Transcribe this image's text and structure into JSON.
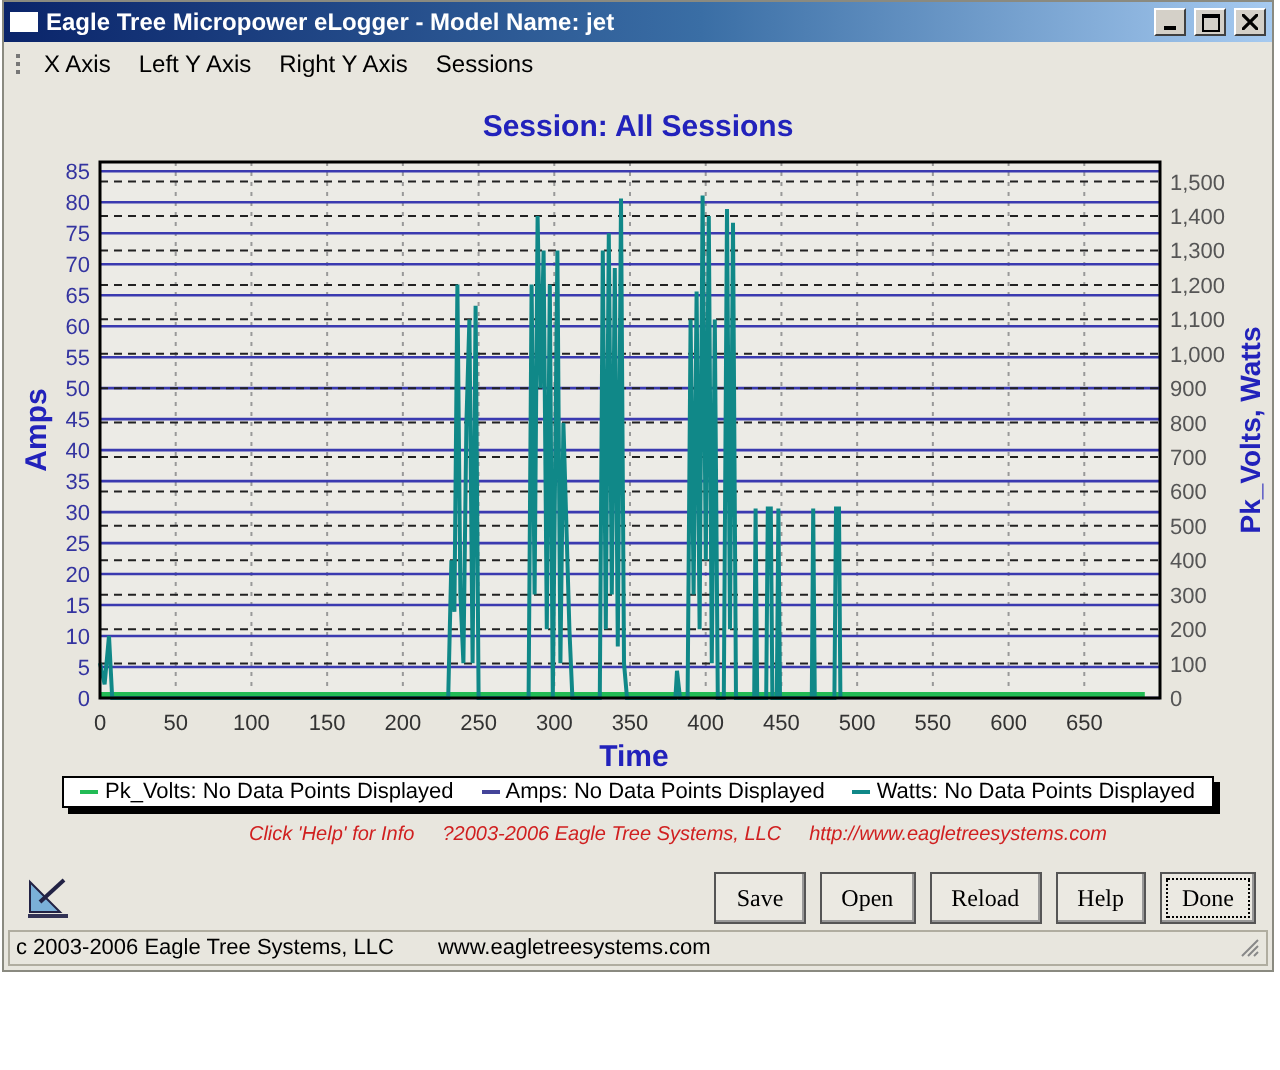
{
  "window": {
    "title": "Eagle Tree Micropower eLogger - Model Name: jet"
  },
  "menu": [
    {
      "label": "X Axis"
    },
    {
      "label": "Left Y Axis"
    },
    {
      "label": "Right Y Axis"
    },
    {
      "label": "Sessions"
    }
  ],
  "graph": {
    "title": "Session: All Sessions",
    "right_axis": {
      "title": "Pk_Volts, Watts",
      "ticks": [
        "1,500",
        "1,400",
        "1,300",
        "1,200",
        "1,100",
        "1,000",
        "900",
        "800",
        "700",
        "600",
        "500",
        "400",
        "300",
        "200",
        "100",
        "0"
      ]
    },
    "chart_data": {
      "type": "line",
      "grid": true,
      "xlabel": "Time",
      "ylabel": "Amps",
      "xlim": [
        0,
        700
      ],
      "ylim": [
        0,
        86.5
      ],
      "xticks": [
        0,
        50,
        100,
        150,
        200,
        250,
        300,
        350,
        400,
        450,
        500,
        550,
        600,
        650
      ],
      "yticks": [
        0,
        5,
        10,
        15,
        20,
        25,
        30,
        35,
        40,
        45,
        50,
        55,
        60,
        65,
        70,
        75,
        80,
        85
      ],
      "x": [
        0,
        3,
        6,
        8,
        230,
        232,
        234,
        236,
        238,
        240,
        242,
        244,
        246,
        248,
        250,
        283,
        285,
        287,
        289,
        291,
        293,
        295,
        297,
        299,
        302,
        304,
        306,
        308,
        310,
        312,
        330,
        332,
        334,
        336,
        338,
        340,
        342,
        344,
        346,
        348,
        380,
        381,
        383,
        388,
        390,
        392,
        394,
        396,
        398,
        400,
        402,
        404,
        406,
        408,
        412,
        414,
        416,
        418,
        420,
        432,
        433,
        434,
        440,
        441,
        443,
        444,
        447,
        448,
        449,
        470,
        471,
        472,
        485,
        486,
        488,
        489,
        690
      ],
      "series": [
        {
          "name": "Pk_Volts",
          "color": "#22bb55",
          "values": [
            0.55,
            0.55,
            0.55,
            0.55,
            0.55,
            0.55,
            0.55,
            0.55,
            0.55,
            0.55,
            0.55,
            0.55,
            0.55,
            0.55,
            0.55,
            0.55,
            0.55,
            0.55,
            0.55,
            0.55,
            0.55,
            0.55,
            0.55,
            0.55,
            0.55,
            0.55,
            0.55,
            0.55,
            0.55,
            0.55,
            0.55,
            0.55,
            0.55,
            0.55,
            0.55,
            0.55,
            0.55,
            0.55,
            0.55,
            0.55,
            0.55,
            0.55,
            0.55,
            0.55,
            0.55,
            0.55,
            0.55,
            0.55,
            0.55,
            0.55,
            0.55,
            0.55,
            0.55,
            0.55,
            0.55,
            0.55,
            0.55,
            0.55,
            0.55,
            0.55,
            0.55,
            0.55,
            0.55,
            0.55,
            0.55,
            0.55,
            0.55,
            0.55,
            0.55,
            0.55,
            0.55,
            0.55,
            0.55,
            0.55,
            0.55,
            0.55,
            0.55
          ]
        },
        {
          "name": "Watts",
          "color": "#108888",
          "values": [
            5.6,
            2.2,
            10,
            0,
            0,
            22.2,
            13.9,
            66.7,
            16.7,
            5.6,
            44.4,
            61.1,
            5.6,
            63.3,
            0,
            0,
            66.7,
            16.7,
            77.8,
            50,
            72.2,
            11.1,
            66.7,
            0,
            72.2,
            5.6,
            44.4,
            27.8,
            11.1,
            0,
            0,
            72.2,
            11.1,
            75,
            16.7,
            69.4,
            8.3,
            80.6,
            5.6,
            0,
            0,
            4.4,
            0,
            0,
            61.1,
            16.7,
            65.6,
            11.1,
            81.1,
            22.2,
            77.8,
            5.6,
            61.1,
            0,
            0,
            78.9,
            11.1,
            76.7,
            0,
            0,
            30.6,
            0,
            0,
            30.6,
            30.6,
            0,
            0,
            30.6,
            0,
            0,
            30.6,
            0,
            0,
            30.6,
            30.6,
            0,
            null
          ]
        }
      ]
    },
    "legend": [
      {
        "note": ": No Data Points Displayed",
        "color": "#22bb55"
      },
      {
        "name": "Amps",
        "note": ": No Data Points Displayed",
        "color": "#444499"
      },
      {
        "note": ": No Data Points Displayed",
        "color": "#108888"
      }
    ],
    "credits": [
      "Click 'Help' for Info",
      "?2003-2006 Eagle Tree Systems, LLC",
      "http://www.eagletreesystems.com"
    ]
  },
  "buttons": [
    {
      "label": "Save",
      "focused": false
    },
    {
      "label": "Open",
      "focused": false
    },
    {
      "label": "Reload",
      "focused": false
    },
    {
      "label": "Help",
      "focused": false
    },
    {
      "label": "Done",
      "focused": true
    }
  ],
  "status_bar": [
    "c 2003-2006 Eagle Tree Systems, LLC",
    "www.eagletreesystems.com"
  ]
}
